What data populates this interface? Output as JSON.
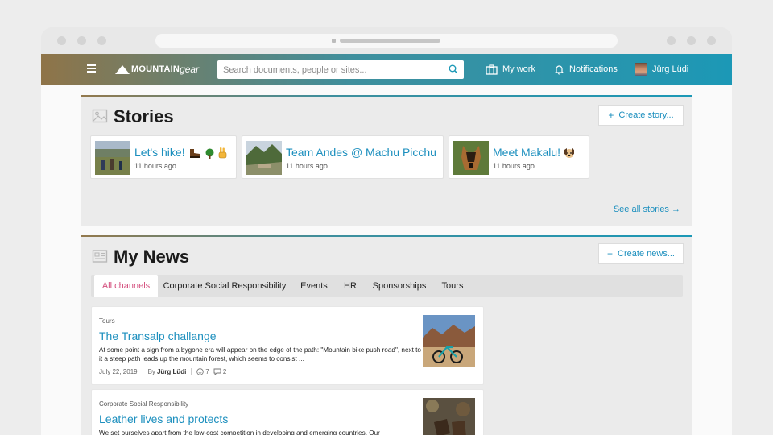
{
  "app": {
    "brand_primary": "MOUNTAIN",
    "brand_secondary": "gear",
    "accent_color": "#1c98b6",
    "link_color": "#1c8fbe",
    "active_tab_color": "#d44f7e"
  },
  "header": {
    "search_placeholder": "Search documents, people or sites...",
    "my_work_label": "My work",
    "notifications_label": "Notifications",
    "user_name": "Jürg Lüdi"
  },
  "stories": {
    "title": "Stories",
    "create_label": "Create story...",
    "see_all_label": "See all stories →",
    "items": [
      {
        "title": "Let's hike!",
        "time": "11 hours ago",
        "emoji": [
          "boot-emoji",
          "tree-emoji",
          "victory-hand-emoji"
        ]
      },
      {
        "title": "Team Andes @ Machu Picchu",
        "time": "11 hours ago",
        "emoji": []
      },
      {
        "title": "Meet Makalu!",
        "time": "11 hours ago",
        "emoji": [
          "dog-face-emoji"
        ]
      }
    ]
  },
  "news": {
    "title": "My News",
    "create_label": "Create news...",
    "tabs": [
      "All channels",
      "Corporate Social Responsibility",
      "Events",
      "HR",
      "Sponsorships",
      "Tours"
    ],
    "active_tab": "All channels",
    "items": [
      {
        "channel": "Tours",
        "title": "The Transalp challange",
        "excerpt": "At some point a sign from a bygone era will appear on the edge of the path: \"Mountain bike push road\", next to it a steep path leads up the mountain forest, which seems to consist ...",
        "date": "July 22, 2019",
        "by_label": "By",
        "author": "Jürg Lüdi",
        "likes": "7",
        "comments": "2"
      },
      {
        "channel": "Corporate Social Responsibility",
        "title": "Leather lives and protects",
        "excerpt": "We set ourselves apart from the low-cost competition in developing and emerging countries. Our"
      }
    ]
  }
}
